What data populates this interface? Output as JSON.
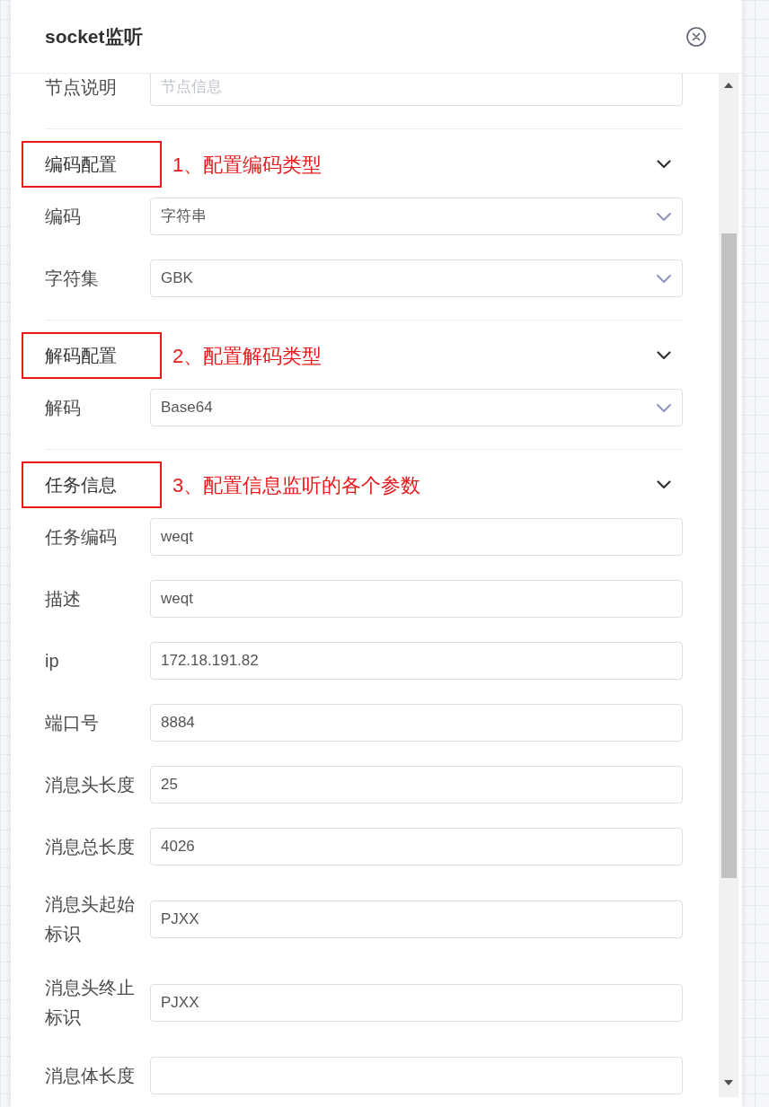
{
  "dialog": {
    "title": "socket监听"
  },
  "fields": [
    {
      "label": "节点说明",
      "kind": "input",
      "placeholder": "节点信息"
    }
  ],
  "sections": [
    {
      "title": "编码配置",
      "annotation": "1、配置编码类型",
      "expanded": true,
      "fields": [
        {
          "label": "编码",
          "kind": "select",
          "value": "字符串"
        },
        {
          "label": "字符集",
          "kind": "select",
          "value": "GBK"
        }
      ]
    },
    {
      "title": "解码配置",
      "annotation": "2、配置解码类型",
      "expanded": true,
      "fields": [
        {
          "label": "解码",
          "kind": "select",
          "value": "Base64"
        }
      ]
    },
    {
      "title": "任务信息",
      "annotation": "3、配置信息监听的各个参数",
      "expanded": true,
      "fields": [
        {
          "label": "任务编码",
          "kind": "input",
          "value": "weqt"
        },
        {
          "label": "描述",
          "kind": "input",
          "value": "weqt"
        },
        {
          "label": "ip",
          "kind": "input",
          "value": "172.18.191.82"
        },
        {
          "label": "端口号",
          "kind": "input",
          "value": "8884"
        },
        {
          "label": "消息头长度",
          "kind": "input",
          "value": "25"
        },
        {
          "label": "消息总长度",
          "kind": "input",
          "value": "4026"
        },
        {
          "label": "消息头起始标识",
          "kind": "input",
          "value": "PJXX"
        },
        {
          "label": "消息头终止标识",
          "kind": "input",
          "value": "PJXX"
        },
        {
          "label": "消息体长度",
          "kind": "input"
        }
      ]
    }
  ]
}
